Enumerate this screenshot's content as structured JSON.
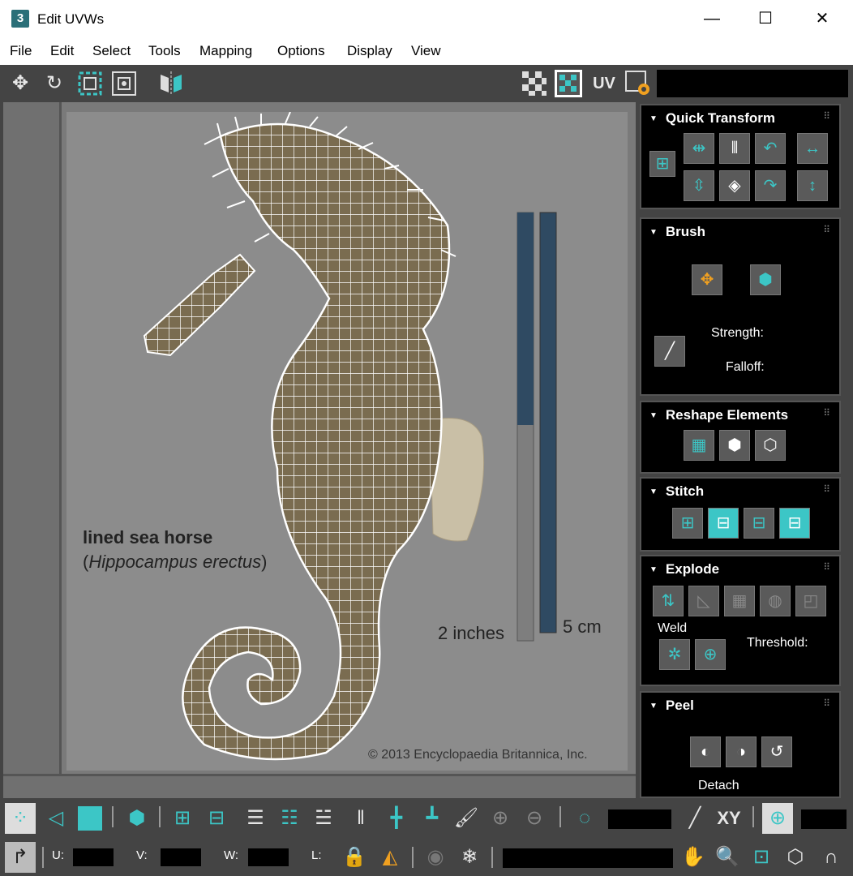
{
  "window": {
    "title": "Edit UVWs",
    "app_icon_text": "3",
    "minimize_glyph": "—",
    "maximize_glyph": "☐",
    "close_glyph": "✕"
  },
  "menu": [
    "File",
    "Edit",
    "Select",
    "Tools",
    "Mapping",
    "Options",
    "Display",
    "View"
  ],
  "toolbar": {
    "uv_label": "UV"
  },
  "viewport": {
    "texture_caption_line1": "lined sea horse",
    "texture_caption_line2_open": "(",
    "texture_caption_line2_italic": "Hippocampus erectus",
    "texture_caption_line2_close": ")",
    "scale_inches": "2 inches",
    "scale_cm": "5 cm",
    "copyright": "© 2013 Encyclopaedia Britannica, Inc."
  },
  "panels": {
    "quick_transform": {
      "title": "Quick Transform"
    },
    "brush": {
      "title": "Brush",
      "strength_label": "Strength:",
      "falloff_label": "Falloff:"
    },
    "reshape": {
      "title": "Reshape Elements"
    },
    "stitch": {
      "title": "Stitch"
    },
    "explode": {
      "title": "Explode",
      "weld_label": "Weld",
      "threshold_label": "Threshold:"
    },
    "peel": {
      "title": "Peel",
      "detach_label": "Detach"
    }
  },
  "bottom": {
    "xy_label": "XY",
    "u_label": "U:",
    "v_label": "V:",
    "w_label": "W:",
    "l_label": "L:"
  },
  "colors": {
    "accent": "#3cc6c6",
    "panel_bg": "#000000",
    "ui_bg": "#444444",
    "scale_bar": "#2f4a62"
  }
}
